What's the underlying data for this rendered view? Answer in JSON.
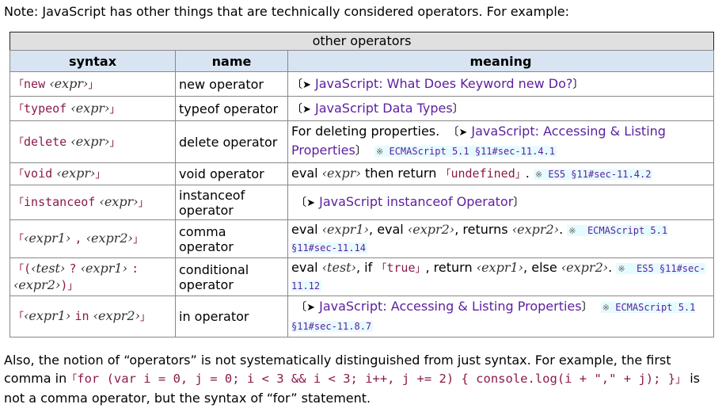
{
  "note": "Note: JavaScript has other things that are technically considered operators. For example:",
  "table": {
    "caption": "other operators",
    "headers": {
      "syntax": "syntax",
      "name": "name",
      "meaning": "meaning"
    },
    "rows": [
      {
        "syntax": {
          "code": "new",
          "var": "‹expr›"
        },
        "name": "new operator",
        "meaning_text": "",
        "link": "JavaScript: What Does Keyword new Do?",
        "ref": ""
      },
      {
        "syntax": {
          "code": "typeof",
          "var": "‹expr›"
        },
        "name": "typeof operator",
        "meaning_text": "",
        "link": "JavaScript Data Types",
        "ref": ""
      },
      {
        "syntax": {
          "code": "delete",
          "var": "‹expr›"
        },
        "name": "delete operator",
        "meaning_text": "For deleting properties.",
        "link": "JavaScript: Accessing & Listing Properties",
        "ref": "ECMAScript 5.1 §11#sec-11.4.1"
      },
      {
        "syntax": {
          "code": "void",
          "var": "‹expr›"
        },
        "name": "void operator",
        "meaning_parts": {
          "a": "eval",
          "var": "‹expr›",
          "b": "then return",
          "code": "undefined",
          "c": "."
        },
        "ref": "ES5 §11#sec-11.4.2"
      },
      {
        "syntax": {
          "code": "instanceof",
          "var": "‹expr›"
        },
        "name": "instanceof operator",
        "link": "JavaScript instanceof Operator"
      },
      {
        "syntax": {
          "var1": "‹expr1›",
          "code": ",",
          "var2": "‹expr2›"
        },
        "name": "comma operator",
        "meaning_parts": {
          "a": "eval",
          "v1": "‹expr1›",
          "b": ", eval",
          "v2": "‹expr2›",
          "c": ", returns",
          "v3": "‹expr2›",
          "d": "."
        },
        "ref": "ECMAScript 5.1 §11#sec-11.14"
      },
      {
        "syntax": {
          "open": "(",
          "test": "‹test›",
          "q": "?",
          "var1": "‹expr1›",
          "colon": ":",
          "var2": "‹expr2›",
          "close": ")"
        },
        "name": "conditional operator",
        "meaning_parts": {
          "a": "eval",
          "v1": "‹test›",
          "b": ", if",
          "code": "true",
          "c": ", return",
          "v2": "‹expr1›",
          "d": ", else",
          "v3": "‹expr2›",
          "e": "."
        },
        "ref": "ES5 §11#sec-11.12"
      },
      {
        "syntax": {
          "var1": "‹expr1›",
          "code": "in",
          "var2": "‹expr2›"
        },
        "name": "in operator",
        "link": "JavaScript: Accessing & Listing Properties",
        "ref": "ECMAScript 5.1 §11#sec-11.8.7"
      }
    ]
  },
  "footer": {
    "line1": "Also, the notion of “operators” is not systematically distinguished from just syntax. For example, the first comma in",
    "code": "for (var i = 0, j = 0; i < 3 && i < 3; i++, j += 2) { console.log(i + \",\" + j); }",
    "line2": "is not a comma operator, but the syntax of “for” statement."
  },
  "glyphs": {
    "open_corner": "「",
    "close_corner": "」",
    "link_open": "〔",
    "link_close": "〕",
    "arrow": "➤",
    "ref_mark": "※"
  }
}
